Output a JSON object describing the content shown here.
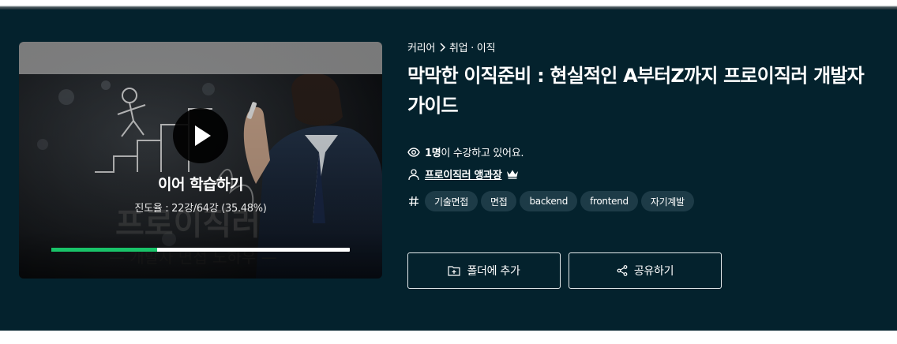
{
  "video": {
    "continue_label": "이어 학습하기",
    "progress_text": "진도율 : 22강/64강 (35.48%)",
    "progress_fraction": 0.3548,
    "play_icon": "play-icon"
  },
  "course": {
    "breadcrumb": {
      "category": "커리어",
      "separator_icon": "chevron-right-icon",
      "subcategory": "취업 · 이직"
    },
    "title": "막막한 이직준비 : 현실적인 A부터Z까지 프로이직러 개발자 가이드",
    "views_count": "1명",
    "views_suffix": "이 수강하고 있어요.",
    "views_icon": "eye-icon",
    "author_icon": "user-icon",
    "author": "프로이직러 앵과장",
    "author_badge_icon": "crown-icon",
    "tags_icon": "hashtag-icon",
    "tags": [
      "기술면접",
      "면접",
      "backend",
      "frontend",
      "자기계발"
    ]
  },
  "actions": {
    "folder_label": "폴더에 추가",
    "folder_icon": "folder-plus-icon",
    "share_label": "공유하기",
    "share_icon": "share-icon"
  },
  "colors": {
    "hero_bg": "#04222d",
    "tag_bg": "#1d3b47",
    "progress": "#19c369"
  }
}
